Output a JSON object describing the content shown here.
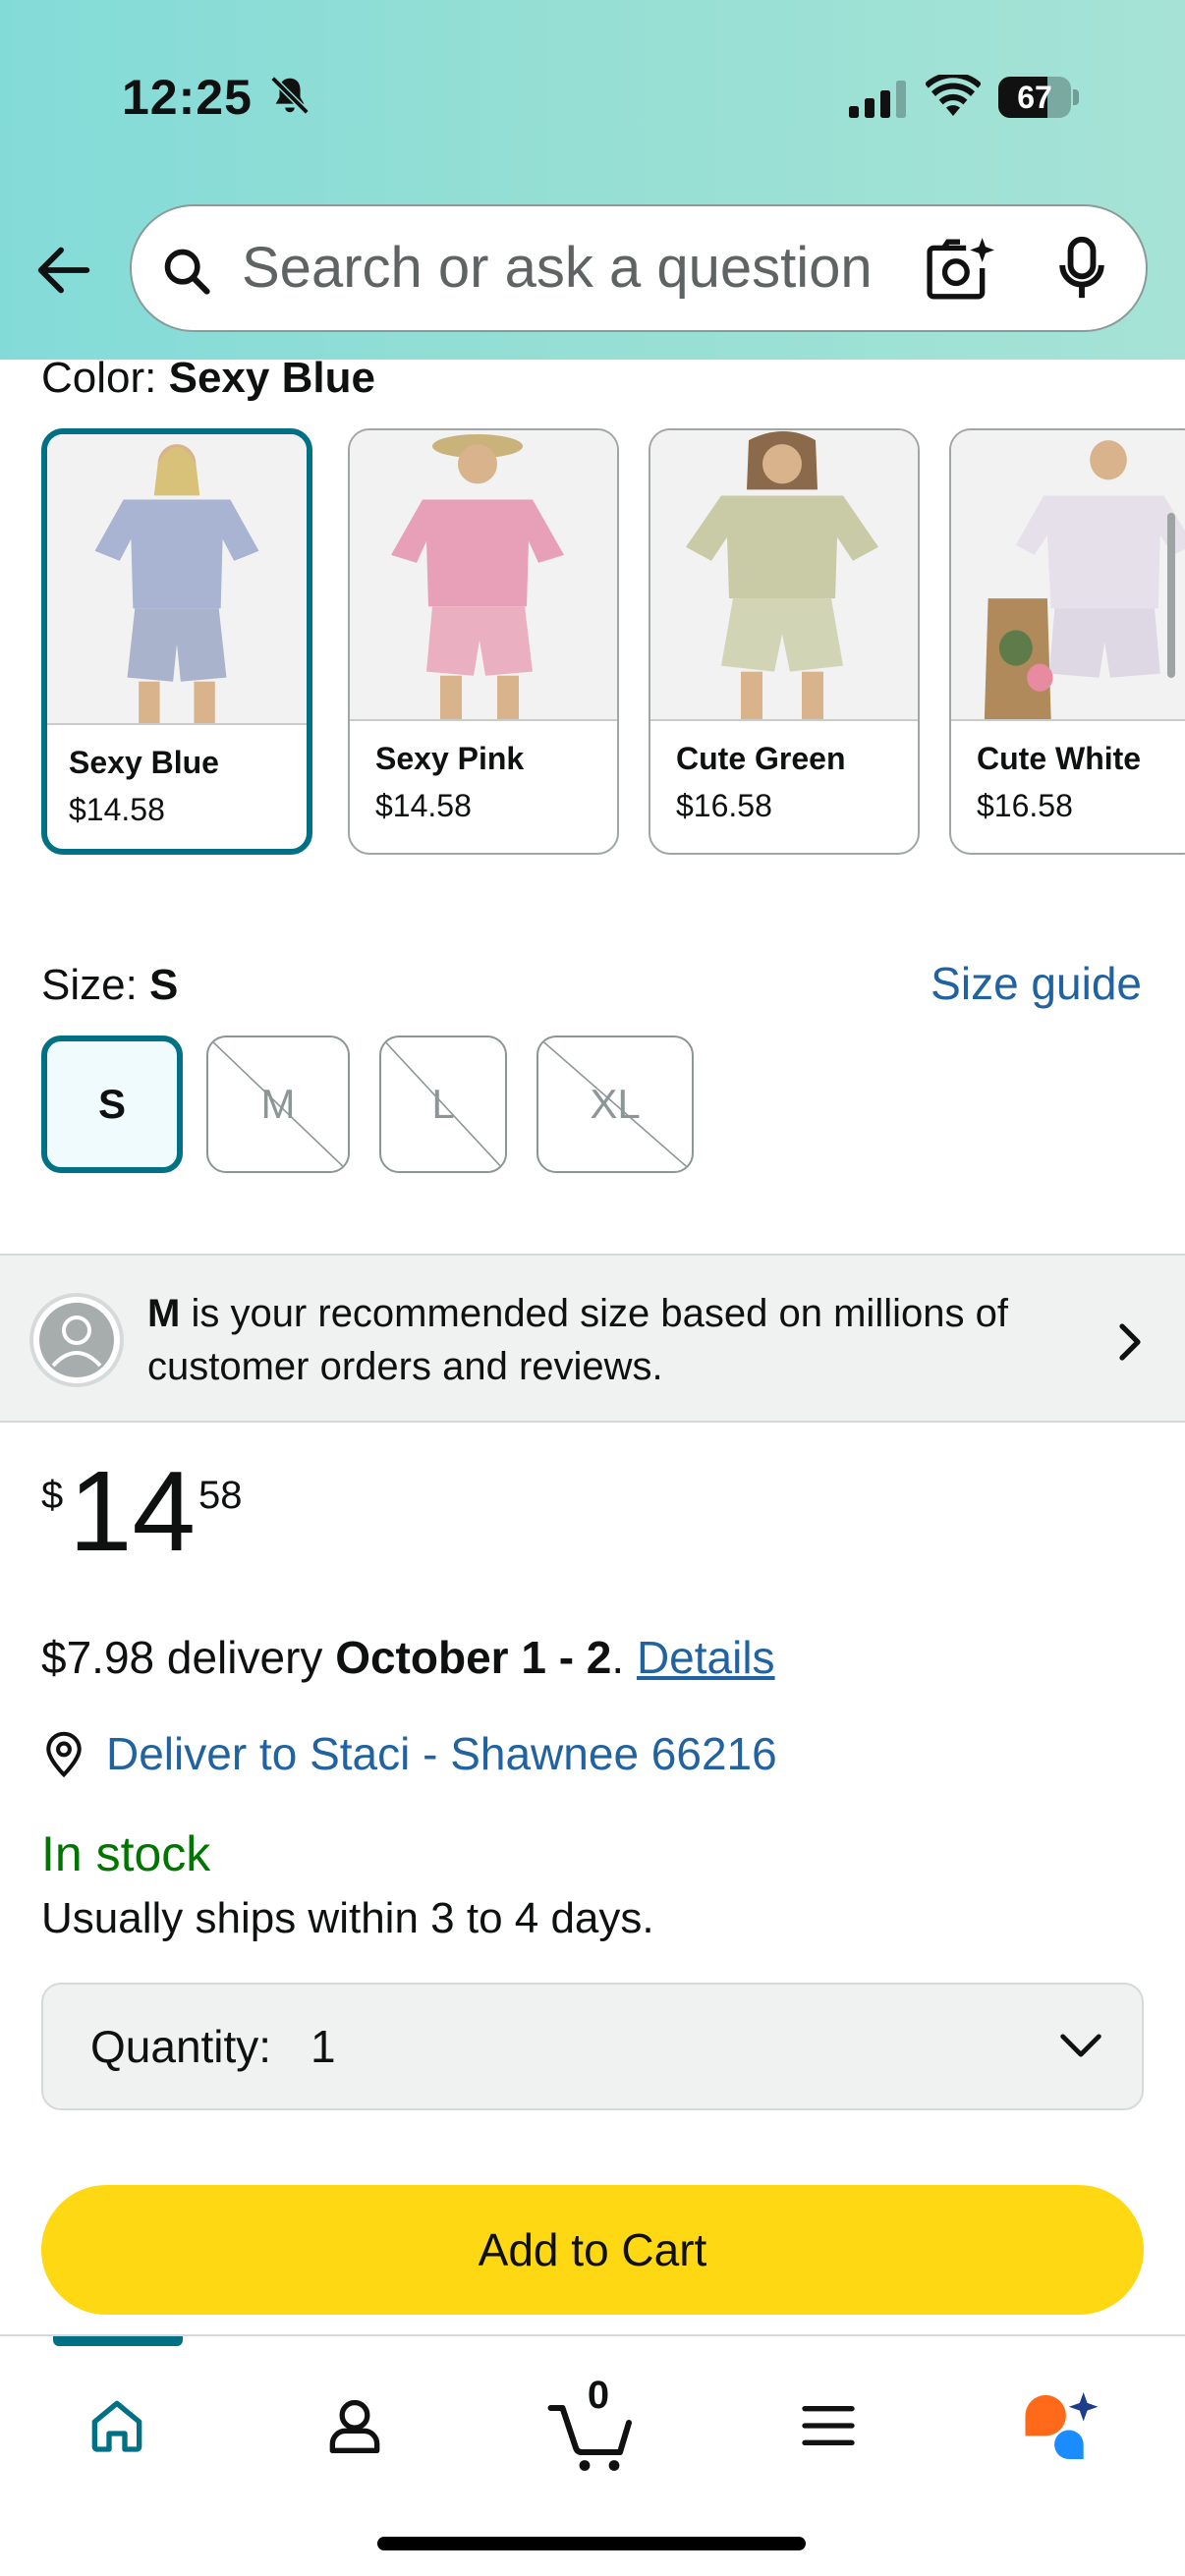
{
  "status_bar": {
    "time": "12:25",
    "battery_level": "67",
    "battery_fraction": 0.67
  },
  "search": {
    "placeholder": "Search or ask a question"
  },
  "color": {
    "label": "Color: ",
    "selected": "Sexy Blue",
    "options": [
      {
        "name": "Sexy Blue",
        "price": "$14.58",
        "top_color": "#a9b4d2",
        "bottom_color": "#aab3cc"
      },
      {
        "name": "Sexy Pink",
        "price": "$14.58",
        "top_color": "#e8a0b8",
        "bottom_color": "#eab0c2"
      },
      {
        "name": "Cute Green",
        "price": "$16.58",
        "top_color": "#c8cba6",
        "bottom_color": "#d2d4b6"
      },
      {
        "name": "Cute White",
        "price": "$16.58",
        "top_color": "#e6e0ea",
        "bottom_color": "#ddd8e4"
      }
    ]
  },
  "size": {
    "label": "Size: ",
    "selected": "S",
    "guide_link": "Size guide",
    "options": [
      "S",
      "M",
      "L",
      "XL"
    ]
  },
  "recommendation": {
    "size": "M",
    "text": " is your recommended size based on millions of customer orders and reviews."
  },
  "price": {
    "symbol": "$",
    "whole": "14",
    "fraction": "58"
  },
  "delivery": {
    "fee": "$7.98 delivery ",
    "dates": "October 1 - 2",
    "separator": ". ",
    "details_link": "Details",
    "deliver_to": "Deliver to Staci - Shawnee 66216"
  },
  "availability": {
    "status": "In stock",
    "ships": "Usually ships within 3 to 4 days."
  },
  "quantity": {
    "label": "Quantity:",
    "value": "1"
  },
  "buttons": {
    "add_to_cart": "Add to Cart"
  },
  "bottom_nav": {
    "cart_count": "0",
    "items": [
      "home-icon",
      "account-icon",
      "cart-icon",
      "menu-icon",
      "rufus-icon"
    ]
  },
  "colors": {
    "accent": "#007185",
    "link": "#2162a1",
    "in_stock": "#007600",
    "add_to_cart": "#ffd814"
  }
}
